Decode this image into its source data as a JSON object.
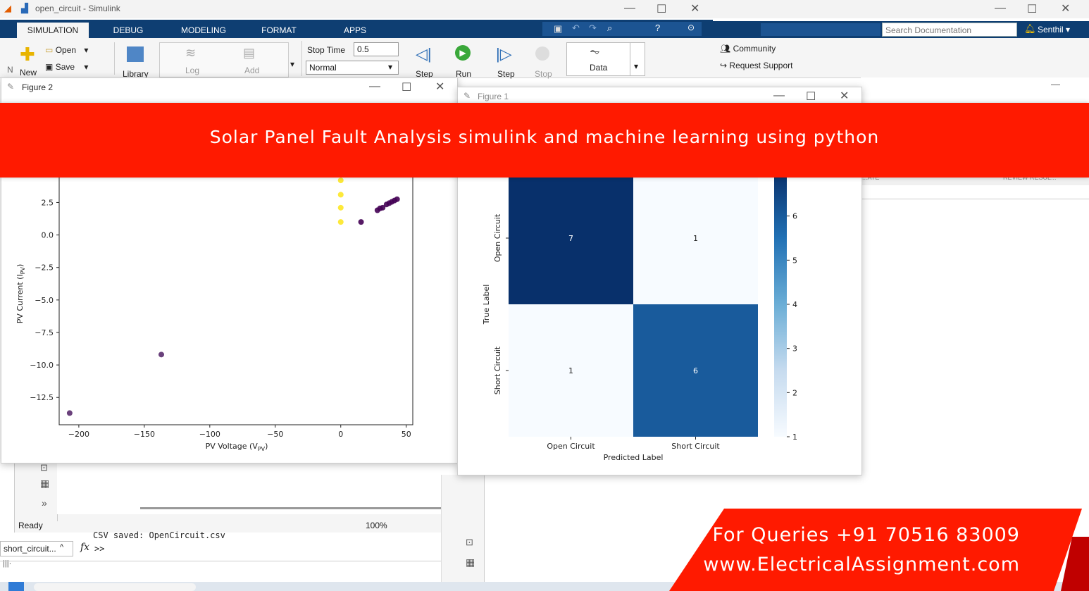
{
  "simulink": {
    "window_title": "open_circuit - Simulink",
    "tabs": [
      "SIMULATION",
      "DEBUG",
      "MODELING",
      "FORMAT",
      "APPS"
    ],
    "ribbon": {
      "new_label": "New",
      "open_label": "Open",
      "save_label": "Save",
      "library_label": "Library",
      "log_label": "Log",
      "add_label": "Add",
      "stop_time_label": "Stop Time",
      "stop_time_value": "0.5",
      "mode_value": "Normal",
      "step_back_label": "Step",
      "run_label": "Run",
      "step_fwd_label": "Step",
      "stop_label": "Stop",
      "data_label": "Data",
      "side_letter": "N"
    },
    "status": "Ready",
    "zoom": "100%"
  },
  "matlab": {
    "search_placeholder": "Search Documentation",
    "user": "Senthil",
    "community_label": "Community",
    "support_label": "Request Support",
    "background_tabs": [
      "...ATE",
      "REVIEW RESUL..."
    ]
  },
  "figure2": {
    "title": "Figure 2",
    "xlabel": "PV Voltage (V",
    "xlabel_sub": "PV",
    "ylabel": "PV Current (I",
    "ylabel_sub": "PV",
    "xticks": [
      "−200",
      "−150",
      "−100",
      "−50",
      "0",
      "50"
    ],
    "yticks": [
      "2.5",
      "0.0",
      "−2.5",
      "−5.0",
      "−7.5",
      "−10.0",
      "−12.5"
    ]
  },
  "figure1": {
    "title": "Figure 1",
    "colorbar_ticks": [
      "6",
      "5",
      "4",
      "3",
      "2",
      "1"
    ]
  },
  "chart_data": [
    {
      "type": "scatter",
      "title": "",
      "xlabel": "PV Voltage (V_PV)",
      "ylabel": "PV Current (I_PV)",
      "xlim": [
        -215,
        55
      ],
      "ylim": [
        -14.6,
        4.8
      ],
      "series": [
        {
          "color": "#fde725",
          "x": [
            0,
            0,
            0,
            0
          ],
          "y": [
            4.2,
            3.1,
            2.1,
            1.0
          ]
        },
        {
          "color": "#440154",
          "x": [
            15.5,
            28,
            30,
            32,
            35,
            37,
            39,
            41,
            43
          ],
          "y": [
            1.0,
            1.9,
            2.05,
            2.1,
            2.35,
            2.45,
            2.55,
            2.65,
            2.75
          ]
        },
        {
          "color": "#5a2c6e",
          "x": [
            -137,
            -207
          ],
          "y": [
            -9.2,
            -13.7
          ]
        }
      ]
    },
    {
      "type": "heatmap",
      "title": "",
      "xlabel": "Predicted Label",
      "ylabel": "True Label",
      "x_categories": [
        "Open Circuit",
        "Short Circuit"
      ],
      "y_categories": [
        "Open Circuit",
        "Short Circuit"
      ],
      "values": [
        [
          7,
          1
        ],
        [
          1,
          6
        ]
      ],
      "colormap": "Blues",
      "colorbar_range": [
        1,
        7
      ]
    }
  ],
  "banner": {
    "text": "Solar Panel Fault Analysis simulink and machine learning using python",
    "color": "#ff1a00"
  },
  "console": {
    "line1": "CSV saved: OpenCircuit.csv",
    "prompt": ">>",
    "file_tab": "short_circuit..."
  },
  "promo": {
    "line1": "For Queries +91 70516 83009",
    "line2": "www.ElectricalAssignment.com",
    "color": "#ff1a00"
  }
}
